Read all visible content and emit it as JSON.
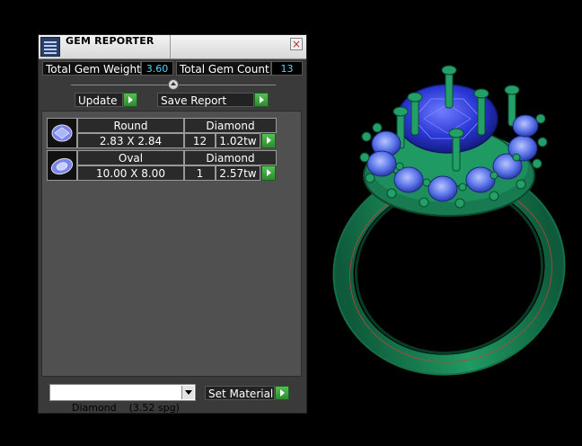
{
  "window": {
    "title": "GEM REPORTER",
    "close_label": "×"
  },
  "stats": {
    "weight_label": "Total Gem Weight",
    "weight_value": "3.60",
    "count_label": "Total Gem Count",
    "count_value": "13"
  },
  "actions": {
    "update_label": "Update",
    "save_label": "Save Report"
  },
  "gems": [
    {
      "shape": "Round",
      "size": "2.83 X 2.84",
      "material": "Diamond",
      "count": "12",
      "weight": "1.02tw",
      "icon": "round-gem-icon"
    },
    {
      "shape": "Oval",
      "size": "10.00 X 8.00",
      "material": "Diamond",
      "count": "1",
      "weight": "2.57tw",
      "icon": "oval-gem-icon"
    }
  ],
  "material": {
    "selected": "Diamond    (3.52 spg)",
    "set_label": "Set Material"
  },
  "colors": {
    "panel": "#3a3a3a",
    "list": "#505050",
    "value_text": "#4fd8ff",
    "accent_green": "#3aa83a",
    "ring_metal": "#1e8a5a",
    "gem_blue": "#2e3fd8"
  }
}
